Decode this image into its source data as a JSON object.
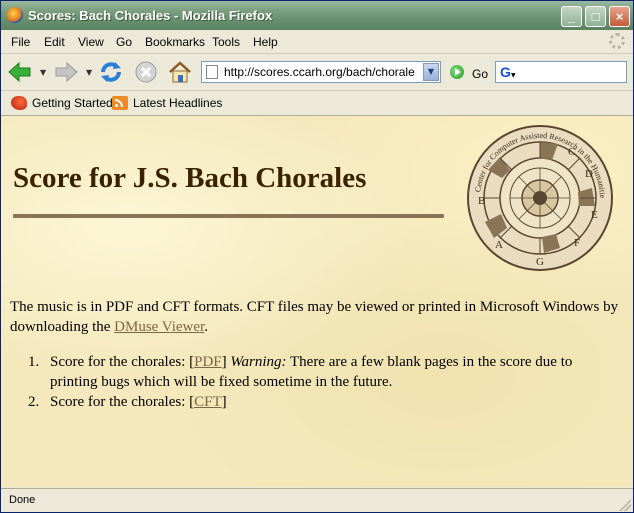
{
  "window": {
    "title": "Scores: Bach Chorales - Mozilla Firefox",
    "minimize_glyph": "_",
    "maximize_glyph": "□",
    "close_glyph": "×"
  },
  "menu": [
    "File",
    "Edit",
    "View",
    "Go",
    "Bookmarks",
    "Tools",
    "Help"
  ],
  "toolbar": {
    "url": "http://scores.ccarh.org/bach/chorale",
    "go_label": "Go",
    "search_value": ""
  },
  "bookmarks": [
    "Getting Started",
    "Latest Headlines"
  ],
  "page": {
    "title": "Score for J.S. Bach Chorales",
    "logo_text": "Center for Computer Assisted Research in the Humanities",
    "logo_letters": [
      "C",
      "D",
      "E",
      "F",
      "G",
      "A",
      "B"
    ],
    "intro_text": "The music is in PDF and CFT formats. CFT files may be viewed or printed in Microsoft Windows by downloading the ",
    "intro_link": "DMuse Viewer",
    "intro_end": ".",
    "items": [
      {
        "number": "1.",
        "text": "Score for the chorales: ",
        "link_open": "[",
        "link": "PDF",
        "link_close": "]",
        "warning_label": "Warning:",
        "warning_text": " There are a few blank pages in the score due to printing bugs which will be fixed sometime in the future."
      },
      {
        "number": "2.",
        "text": "Score for the chorales: ",
        "link_open": "[",
        "link": "CFT",
        "link_close": "]"
      }
    ]
  },
  "status": "Done",
  "colors": {
    "page_bg": "#f4e8bc",
    "title_color": "#3a2200",
    "link_color": "#7a6845",
    "rule_color": "#8a7456",
    "titlebar": "#7da282"
  }
}
